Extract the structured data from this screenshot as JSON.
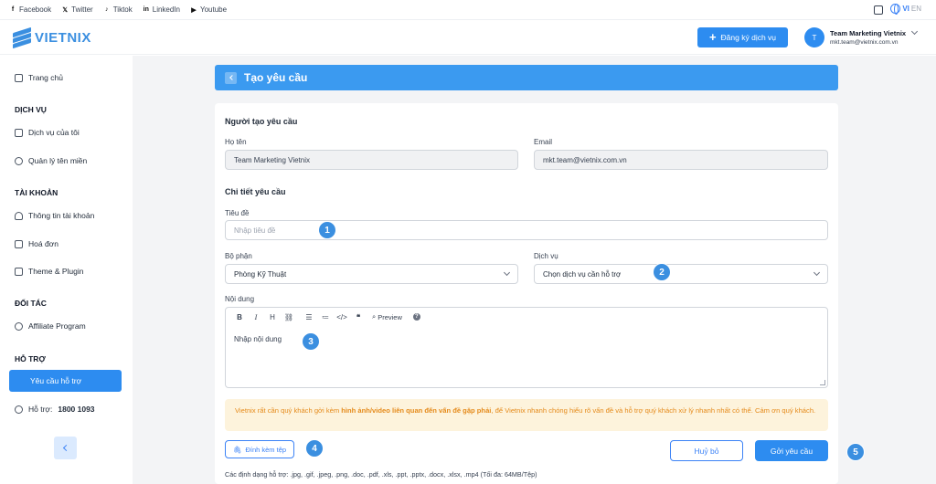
{
  "social": [
    {
      "label": "Facebook",
      "icon": "facebook-icon",
      "glyph": "f"
    },
    {
      "label": "Twitter",
      "icon": "x-icon",
      "glyph": "𝕏"
    },
    {
      "label": "Tiktok",
      "icon": "tiktok-icon",
      "glyph": "♪"
    },
    {
      "label": "LinkedIn",
      "icon": "linkedin-icon",
      "glyph": "in"
    },
    {
      "label": "Youtube",
      "icon": "youtube-icon",
      "glyph": "▶"
    }
  ],
  "lang": {
    "active": "VI",
    "other": "EN"
  },
  "brand": {
    "name": "VIETNIX",
    "color": "#3b8fe0"
  },
  "header": {
    "register_label": "Đăng ký dịch vụ",
    "user": {
      "initial": "T",
      "name": "Team Marketing Vietnix",
      "email": "mkt.team@vietnix.com.vn"
    }
  },
  "sidebar": {
    "home": "Trang chủ",
    "section_services": "DỊCH VỤ",
    "my_services": "Dịch vụ của tôi",
    "domains": "Quản lý tên miền",
    "section_account": "TÀI KHOẢN",
    "account_info": "Thông tin tài khoản",
    "invoices": "Hoá đơn",
    "themes": "Theme & Plugin",
    "section_partner": "ĐỐI TÁC",
    "affiliate": "Affiliate Program",
    "section_support": "HỖ TRỢ",
    "support_request": "Yêu cầu hỗ trợ",
    "hotline_label": "Hỗ trợ:",
    "hotline_number": "1800 1093"
  },
  "page": {
    "title": "Tạo yêu cầu"
  },
  "form": {
    "requester_title": "Người tạo yêu cầu",
    "name_label": "Họ tên",
    "name_value": "Team Marketing Vietnix",
    "email_label": "Email",
    "email_value": "mkt.team@vietnix.com.vn",
    "details_title": "Chi tiết yêu cầu",
    "subject_label": "Tiêu đề",
    "subject_placeholder": "Nhập tiêu đề",
    "department_label": "Bộ phận",
    "department_value": "Phòng Kỹ Thuật",
    "service_label": "Dịch vụ",
    "service_value": "Chọn dịch vụ cần hỗ trợ",
    "content_label": "Nội dung",
    "content_placeholder": "Nhập nội dung",
    "toolbar": {
      "bold": "B",
      "italic": "I",
      "heading": "H",
      "preview": "Preview"
    },
    "notice_part1": "Vietnix rất cần quý khách gởi kèm ",
    "notice_bold": "hình ảnh/video liên quan đến vấn đề gặp phải",
    "notice_part2": ", để Vietnix nhanh chóng hiểu rõ vấn đề và hỗ trợ quý khách xử lý nhanh nhất có thể. Cảm ơn quý khách.",
    "attach_label": "Đính kèm tệp",
    "cancel_label": "Huỷ bỏ",
    "submit_label": "Gởi yêu cầu",
    "formats_text": "Các định dạng hỗ trợ: .jpg, .gif, .jpeg, .png, .doc, .pdf, .xls, .ppt, .pptx, .docx, .xlsx, .mp4 (Tối đa: 64MB/Tệp)"
  },
  "markers": [
    "1",
    "2",
    "3",
    "4",
    "5"
  ],
  "colors": {
    "primary": "#2d8cf0",
    "notice_bg": "#fdf3dc",
    "notice_text": "#e58a1a"
  }
}
